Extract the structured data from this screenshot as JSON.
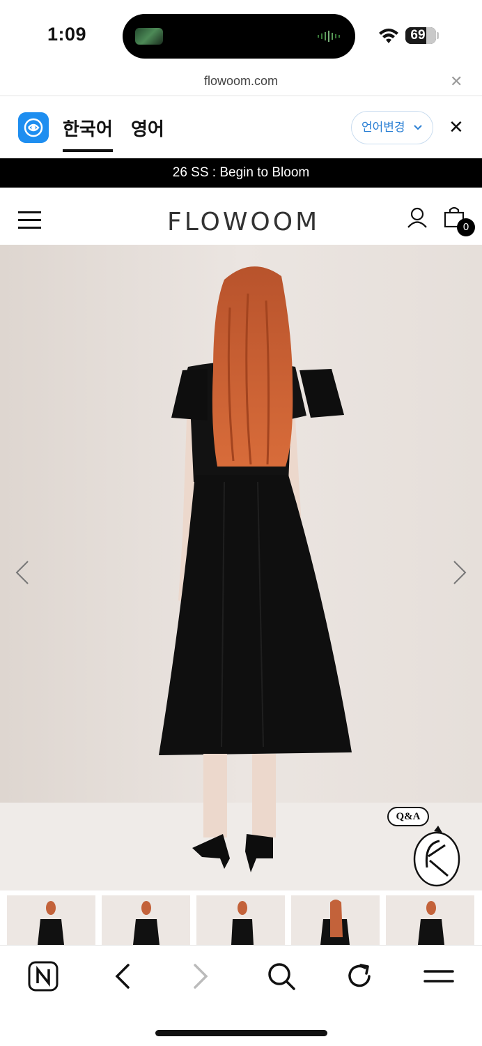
{
  "status_bar": {
    "time": "1:09",
    "battery": "69",
    "battery_level": 0.69,
    "icons": [
      "wifi-icon",
      "battery-icon"
    ]
  },
  "url_bar": {
    "url": "flowoom.com",
    "close": "✕"
  },
  "translate_bar": {
    "tabs": [
      {
        "label": "한국어",
        "active": true
      },
      {
        "label": "영어",
        "active": false
      }
    ],
    "change_label": "언어변경",
    "close": "✕",
    "accent_color": "#1e8ef0"
  },
  "announcement": "26 SS : Begin to Bloom",
  "header": {
    "logo": "FLOWOOM",
    "cart_count": "0"
  },
  "hero": {
    "qa_label": "Q&A"
  },
  "thumbnails": [
    {
      "name": "thumbnail-1"
    },
    {
      "name": "thumbnail-2"
    },
    {
      "name": "thumbnail-3"
    },
    {
      "name": "thumbnail-4"
    },
    {
      "name": "thumbnail-5"
    }
  ],
  "toolbar": {
    "items": [
      "naver-home-icon",
      "back-icon",
      "forward-icon",
      "search-icon",
      "reload-icon",
      "menu-icon"
    ]
  }
}
